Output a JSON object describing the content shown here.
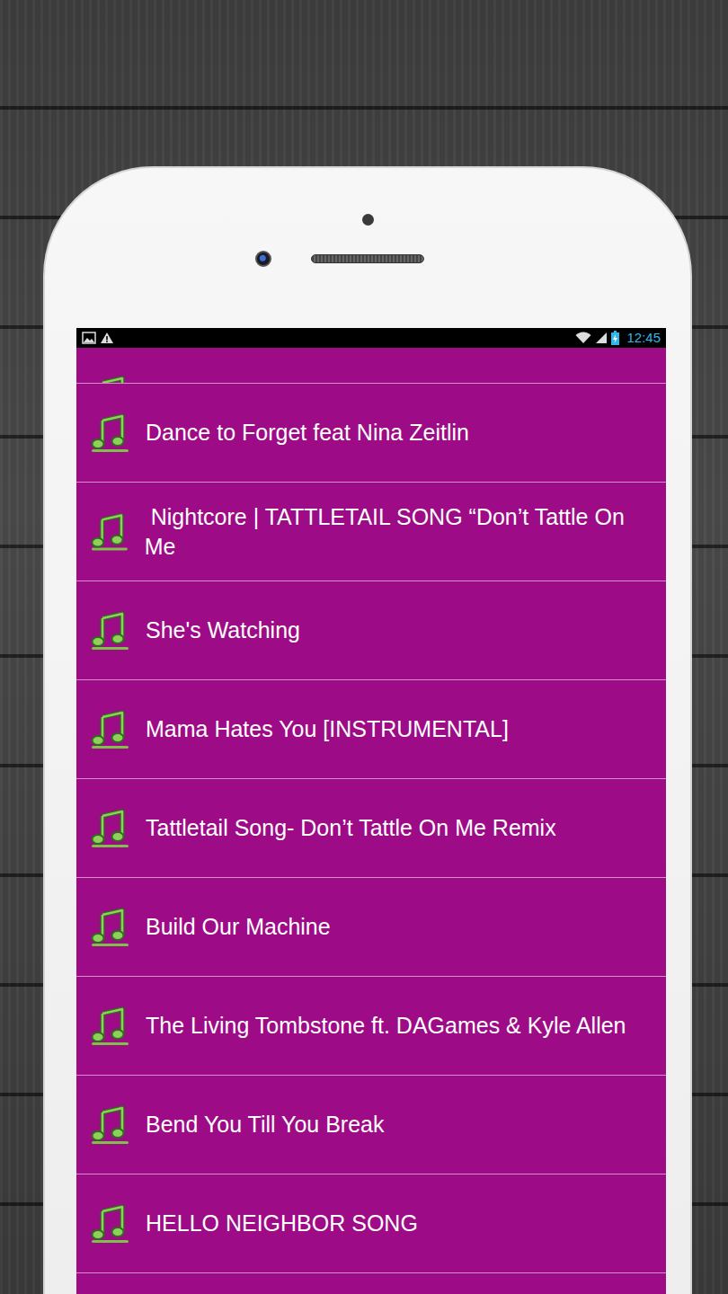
{
  "status_bar": {
    "time": "12:45"
  },
  "songs": [
    {
      "title": "Dance to Forget feat Nina Zeitlin"
    },
    {
      "title": " Nightcore | TATTLETAIL SONG “Don’t Tattle On Me"
    },
    {
      "title": "She's Watching"
    },
    {
      "title": "Mama Hates You [INSTRUMENTAL]"
    },
    {
      "title": "Tattletail Song- Don’t Tattle On Me Remix"
    },
    {
      "title": "Build Our Machine"
    },
    {
      "title": "The Living Tombstone ft. DAGames & Kyle Allen"
    },
    {
      "title": "Bend You Till You Break"
    },
    {
      "title": "HELLO NEIGHBOR SONG"
    }
  ]
}
